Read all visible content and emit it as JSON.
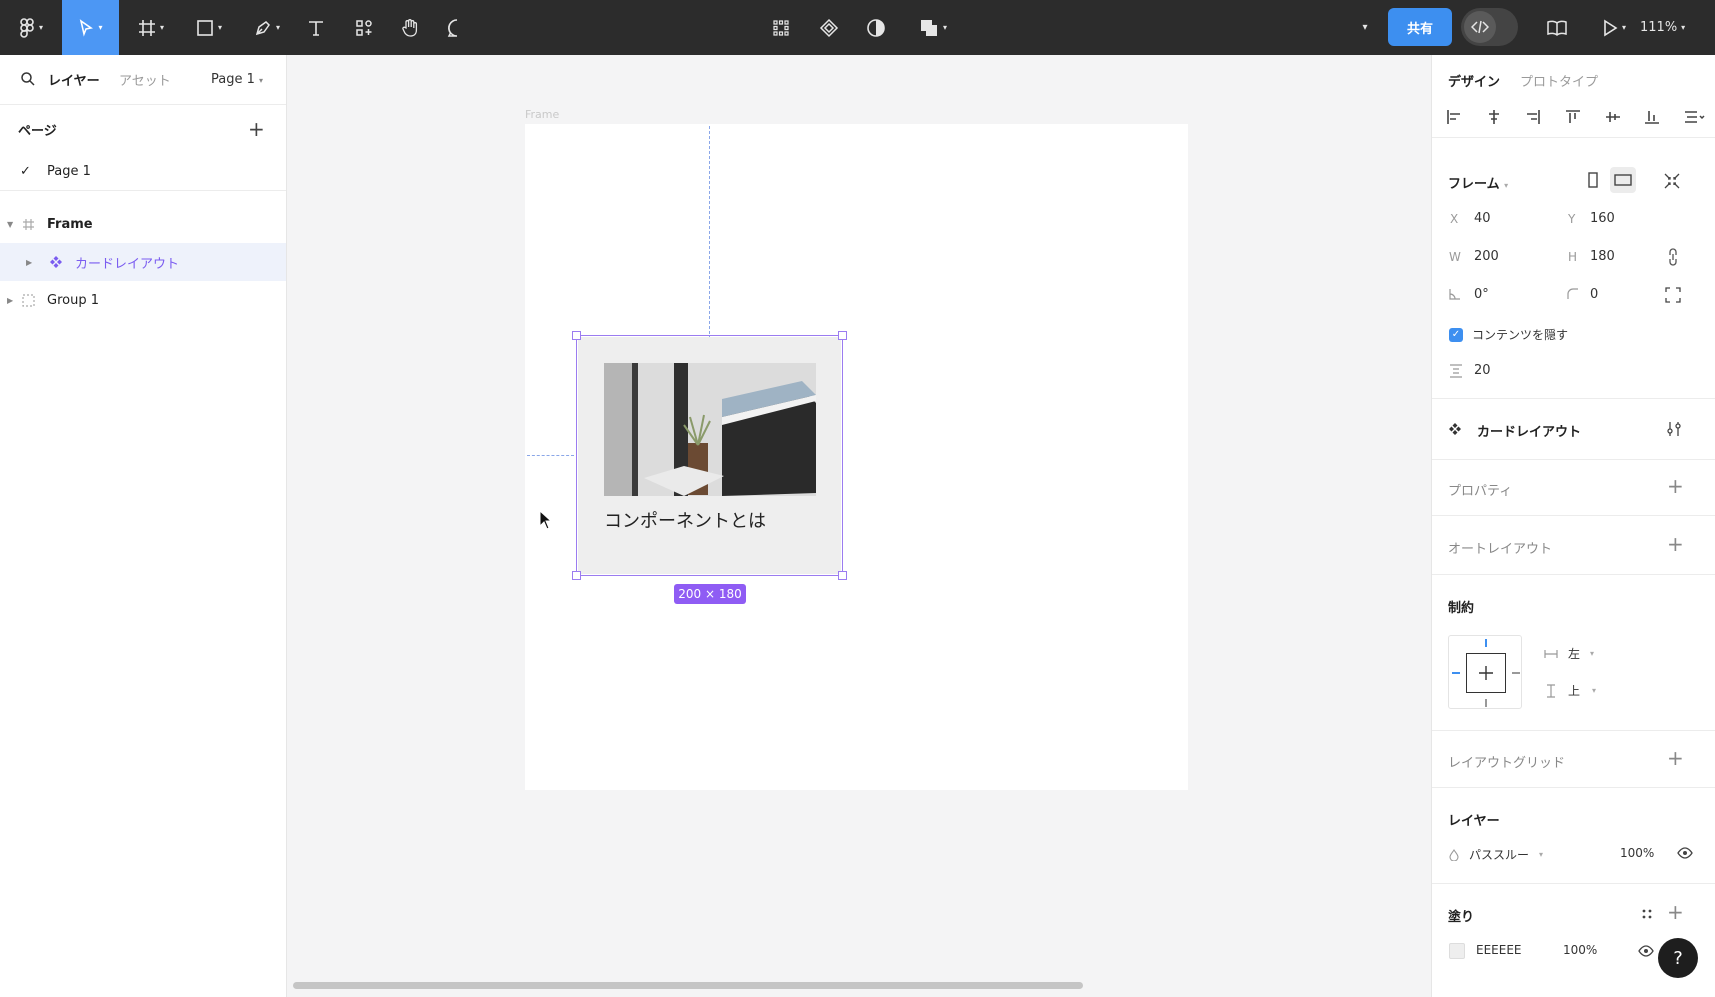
{
  "toolbar": {
    "share_label": "共有",
    "zoom": "111%",
    "tools": [
      "main-menu",
      "move",
      "frame",
      "shape",
      "pen",
      "text",
      "resources",
      "hand",
      "comment"
    ],
    "center_tools": [
      "component-grid",
      "component",
      "contrast",
      "boolean"
    ],
    "accent_color": "#4c97f4"
  },
  "left_panel": {
    "tabs": {
      "layers": "レイヤー",
      "assets": "アセット",
      "page_selector": "Page 1"
    },
    "pages": {
      "title": "ページ",
      "items": [
        {
          "label": "Page 1",
          "selected": true
        }
      ]
    },
    "layers": [
      {
        "label": "Frame",
        "type": "frame"
      },
      {
        "label": "カードレイアウト",
        "type": "instance",
        "selected": true
      },
      {
        "label": "Group 1",
        "type": "group"
      }
    ]
  },
  "canvas": {
    "frame_label": "Frame",
    "card_title": "コンポーネントとは",
    "size_badge": "200 × 180",
    "selection_color": "#9b7cf0"
  },
  "right_panel": {
    "tabs": {
      "design": "デザイン",
      "prototype": "プロトタイプ"
    },
    "frame": {
      "title": "フレーム",
      "x_label": "X",
      "x": "40",
      "y_label": "Y",
      "y": "160",
      "w_label": "W",
      "w": "200",
      "h_label": "H",
      "h": "180",
      "rotation": "0°",
      "radius": "0",
      "clip_label": "コンテンツを隠す",
      "clip_checked": true,
      "spacing": "20"
    },
    "component": {
      "name": "カードレイアウト"
    },
    "properties": {
      "title": "プロパティ"
    },
    "auto_layout": {
      "title": "オートレイアウト"
    },
    "constraints": {
      "title": "制約",
      "horizontal": "左",
      "vertical": "上"
    },
    "layout_grid": {
      "title": "レイアウトグリッド"
    },
    "layer": {
      "title": "レイヤー",
      "blend": "パススルー",
      "opacity": "100%"
    },
    "fill": {
      "title": "塗り",
      "hex": "EEEEEE",
      "opacity": "100%",
      "color": "#eeeeee"
    },
    "help": "?"
  }
}
